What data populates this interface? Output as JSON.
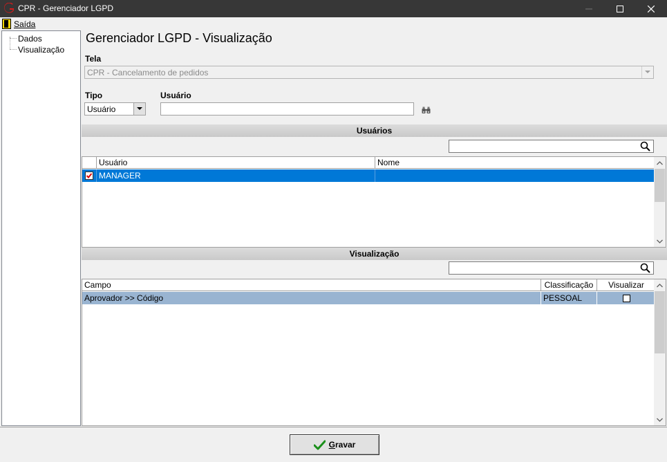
{
  "window": {
    "title": "CPR - Gerenciador LGPD"
  },
  "menu": {
    "exit_label": "Saída"
  },
  "tree": {
    "items": [
      {
        "label": "Dados"
      },
      {
        "label": "Visualização"
      }
    ]
  },
  "page": {
    "heading": "Gerenciador LGPD - Visualização"
  },
  "form": {
    "tela_label": "Tela",
    "tela_value": "CPR - Cancelamento de pedidos",
    "tipo_label": "Tipo",
    "tipo_value": "Usuário",
    "usuario_label": "Usuário",
    "usuario_value": ""
  },
  "usuarios_section": {
    "title": "Usuários",
    "search_value": "",
    "columns": [
      "Usuário",
      "Nome"
    ],
    "rows": [
      {
        "checked": true,
        "usuario": "MANAGER",
        "nome": ""
      }
    ]
  },
  "visualizacao_section": {
    "title": "Visualização",
    "search_value": "",
    "columns": [
      "Campo",
      "Classificação",
      "Visualizar"
    ],
    "rows": [
      {
        "campo": "Aprovador >> Código",
        "classificacao": "PESSOAL",
        "visualizar": false
      }
    ]
  },
  "footer": {
    "save_label_first": "G",
    "save_label_rest": "ravar"
  },
  "colors": {
    "titlebar": "#373737",
    "selection": "#0078d7",
    "row_highlight": "#99b4d1"
  },
  "icons": [
    "app-logo-icon",
    "minimize-icon",
    "maximize-icon",
    "close-icon",
    "exit-door-icon",
    "chevron-down-icon",
    "binoculars-icon",
    "search-icon",
    "checkbox-checked-icon",
    "checkbox-icon",
    "scroll-up-icon",
    "scroll-down-icon",
    "green-check-icon"
  ]
}
